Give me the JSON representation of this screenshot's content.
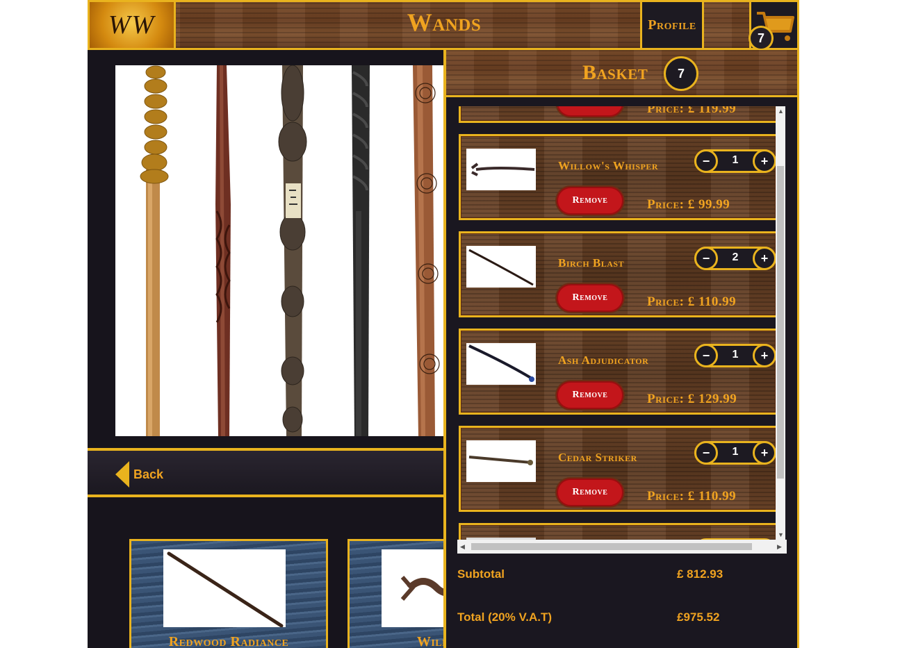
{
  "header": {
    "logo_text": "WW",
    "title": "Wands",
    "profile_label": "Profile",
    "cart_count": "7"
  },
  "nav": {
    "back_label": "Back"
  },
  "related": [
    {
      "name": "Redwood Radiance"
    },
    {
      "name": "Willow's"
    }
  ],
  "basket": {
    "title": "Basket",
    "count": "7",
    "partial_top_price": "Price: £ 119.99",
    "items": [
      {
        "name": "Willow's Whisper",
        "qty": "1",
        "remove_label": "Remove",
        "price": "Price: £ 99.99"
      },
      {
        "name": "Birch Blast",
        "qty": "2",
        "remove_label": "Remove",
        "price": "Price: £ 110.99"
      },
      {
        "name": "Ash Adjudicator",
        "qty": "1",
        "remove_label": "Remove",
        "price": "Price: £ 129.99"
      },
      {
        "name": "Cedar Striker",
        "qty": "1",
        "remove_label": "Remove",
        "price": "Price: £ 110.99"
      }
    ],
    "qty_minus": "−",
    "qty_plus": "+",
    "subtotal_label": "Subtotal",
    "subtotal_value": "£ 812.93",
    "total_label": "Total (20% V.A.T)",
    "total_value": "£975.52"
  },
  "colors": {
    "accent": "#e9b31e",
    "text_gold": "#f0a320",
    "remove_red": "#c3161b",
    "panel_dark": "#1a1720"
  },
  "icons": [
    "cart-icon",
    "back-arrow-icon",
    "scroll-up-arrow-icon",
    "scroll-down-arrow-icon"
  ]
}
